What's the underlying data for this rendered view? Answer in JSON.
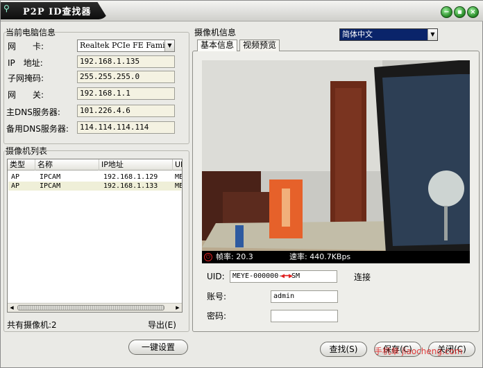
{
  "window": {
    "title": "P2P ID查找器",
    "language_select": "简体中文"
  },
  "local_info": {
    "group_title": "当前电脑信息",
    "nic_label": "网　　卡:",
    "nic_value": "Realtek PCIe FE Family",
    "ip_label": "IP　地址:",
    "ip_value": "192.168.1.135",
    "mask_label": "子网掩码:",
    "mask_value": "255.255.255.0",
    "gateway_label": "网　　关:",
    "gateway_value": "192.168.1.1",
    "dns1_label": "主DNS服务器:",
    "dns1_value": "101.226.4.6",
    "dns2_label": "备用DNS服务器:",
    "dns2_value": "114.114.114.114"
  },
  "camera_list": {
    "group_title": "摄像机列表",
    "columns": [
      "类型",
      "名称",
      "IP地址",
      "UI"
    ],
    "rows": [
      {
        "type": "AP",
        "name": "IPCAM",
        "ip": "192.168.1.129",
        "extra": "ME"
      },
      {
        "type": "AP",
        "name": "IPCAM",
        "ip": "192.168.1.133",
        "extra": "ME"
      }
    ],
    "total_label": "共有摄像机:2",
    "export_label": "导出(E)"
  },
  "camera_info": {
    "group_title": "摄像机信息",
    "tabs": [
      "基本信息",
      "视频预览"
    ],
    "fps_label": "帧率: 20.3",
    "rate_label": "速率: 440.7KBps",
    "uid_label": "UID:",
    "uid_value": "MEYE-000000-",
    "uid_suffix": "SM",
    "connect_label": "连接",
    "account_label": "账号:",
    "account_value": "admin",
    "password_label": "密码:",
    "password_value": ""
  },
  "buttons": {
    "one_key": "一键设置",
    "search": "查找(S)",
    "save": "保存(C)",
    "close": "关闭(C)"
  },
  "watermark": "手机单 jiaocheng.com",
  "colors": {
    "title_bar": "#111111",
    "window_button": "#2a8d2a",
    "accent_red": "#e02020"
  }
}
